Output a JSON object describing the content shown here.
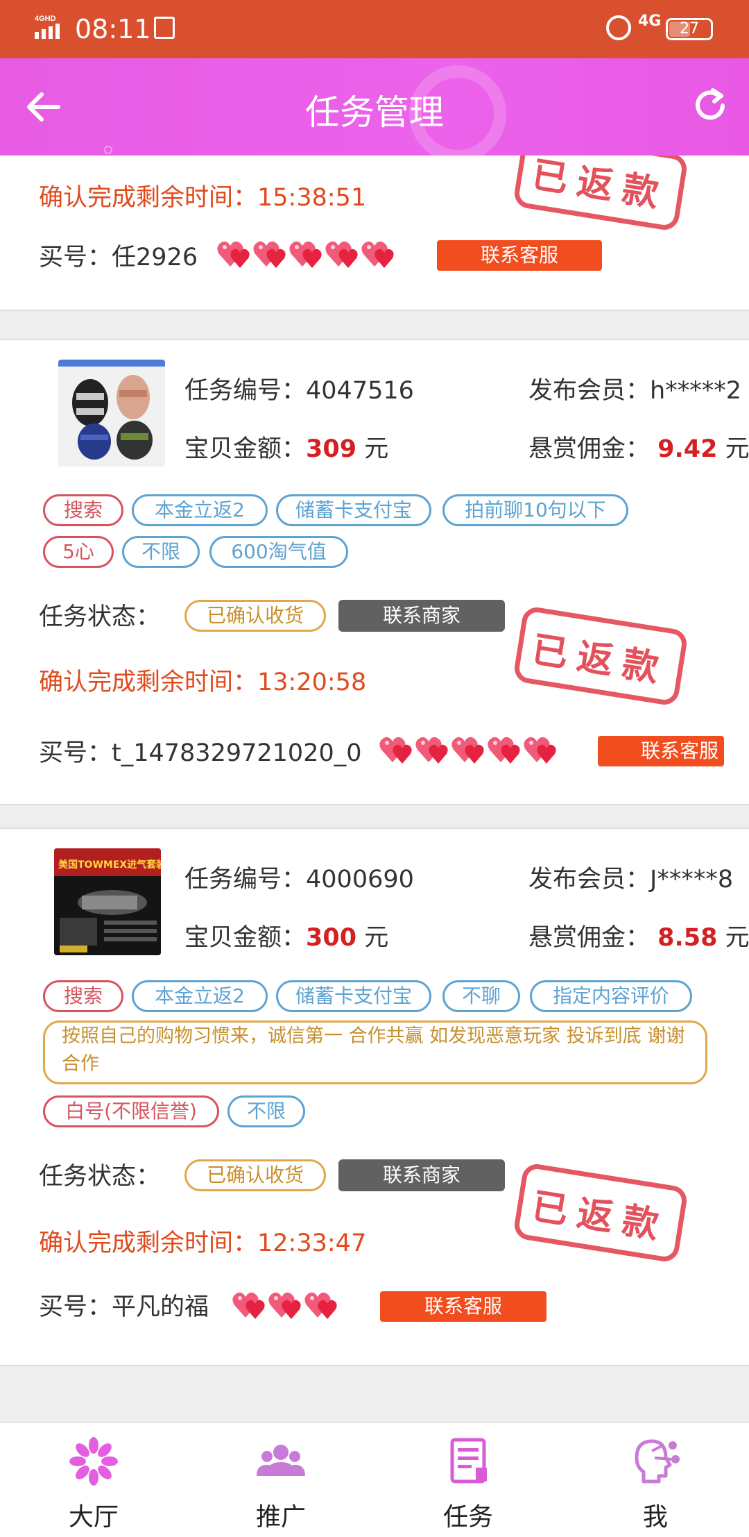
{
  "status_bar": {
    "network_left": "4G HD",
    "time": "08:11",
    "network_right": "4G",
    "battery": "27"
  },
  "header": {
    "title": "任务管理",
    "back_icon": "back-arrow-icon",
    "refresh_icon": "refresh-icon"
  },
  "card0": {
    "countdown_label": "确认完成剩余时间：",
    "countdown": "15:38:51",
    "buyer_label": "买号：",
    "buyer": "任2926",
    "hearts": 5,
    "contact_service": "联系客服",
    "stamp": "已返款"
  },
  "card1": {
    "task_no_label": "任务编号：",
    "task_no": "4047516",
    "publisher_label": "发布会员：",
    "publisher": "h*****2",
    "amount_label": "宝贝金额：",
    "amount": "309",
    "amount_unit": "元",
    "reward_label": "悬赏佣金：",
    "reward": "9.42",
    "reward_unit": "元",
    "tags": [
      "搜索",
      "本金立返2",
      "储蓄卡支付宝",
      "拍前聊10句以下",
      "5心",
      "不限",
      "600淘气值"
    ],
    "status_label": "任务状态：",
    "status": "已确认收货",
    "contact_merchant": "联系商家",
    "countdown_label": "确认完成剩余时间：",
    "countdown": "13:20:58",
    "buyer_label": "买号：",
    "buyer": "t_1478329721020_0",
    "hearts": 5,
    "contact_service": "联系客服",
    "stamp": "已返款"
  },
  "card2": {
    "task_no_label": "任务编号：",
    "task_no": "4000690",
    "publisher_label": "发布会员：",
    "publisher": "J*****8",
    "amount_label": "宝贝金额：",
    "amount": "300",
    "amount_unit": "元",
    "reward_label": "悬赏佣金：",
    "reward": "8.58",
    "reward_unit": "元",
    "product_image_text": "美国TOWMEX进气套装件",
    "tags": [
      "搜索",
      "本金立返2",
      "储蓄卡支付宝",
      "不聊",
      "指定内容评价"
    ],
    "note": "按照自己的购物习惯来，诚信第一 合作共赢 如发现恶意玩家 投诉到底 谢谢合作",
    "tags2": [
      "白号(不限信誉)",
      "不限"
    ],
    "status_label": "任务状态：",
    "status": "已确认收货",
    "contact_merchant": "联系商家",
    "countdown_label": "确认完成剩余时间：",
    "countdown": "12:33:47",
    "buyer_label": "买号：",
    "buyer": "平凡的福",
    "hearts": 3,
    "contact_service": "联系客服",
    "stamp": "已返款"
  },
  "tabbar": {
    "items": [
      {
        "label": "大厅",
        "icon": "flower-icon"
      },
      {
        "label": "推广",
        "icon": "people-icon"
      },
      {
        "label": "任务",
        "icon": "document-icon"
      },
      {
        "label": "我",
        "icon": "profile-icon"
      }
    ]
  },
  "colors": {
    "statusbar": "#d9502f",
    "header": "#e85ce4",
    "accent_red": "#e04a1c",
    "price_red": "#d42020",
    "tab_icon": "#e05ee0"
  }
}
